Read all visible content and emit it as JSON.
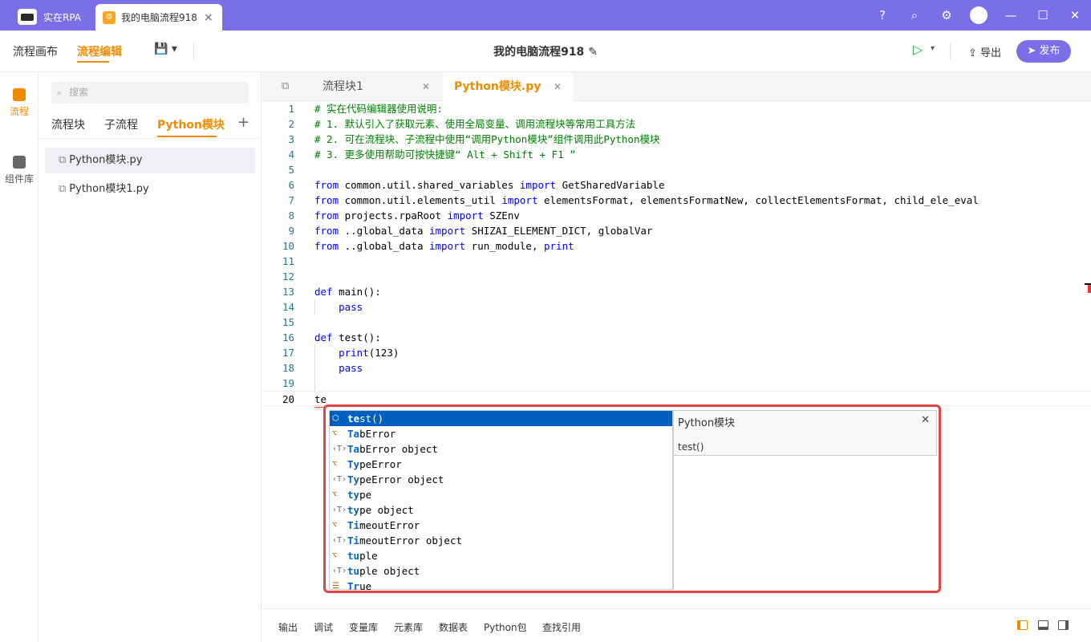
{
  "app": {
    "name": "实在RPA",
    "doc_tab": "我的电脑流程918"
  },
  "toolbar": {
    "canvas": "流程画布",
    "edit": "流程编辑",
    "title": "我的电脑流程918",
    "export": "导出",
    "publish": "发布"
  },
  "leftbar": {
    "flow": "流程",
    "lib": "组件库"
  },
  "sidebar": {
    "search_placeholder": "搜索",
    "tabs": [
      "流程块",
      "子流程",
      "Python模块"
    ],
    "files": [
      "Python模块.py",
      "Python模块1.py"
    ]
  },
  "editor": {
    "tabs": [
      "流程块1",
      "Python模块.py"
    ]
  },
  "code": {
    "lines": [
      {
        "n": "1",
        "t": "# 实在代码编辑器使用说明:"
      },
      {
        "n": "2",
        "t": "# 1. 默认引入了获取元素、使用全局变量、调用流程块等常用工具方法"
      },
      {
        "n": "3",
        "t": "# 2. 可在流程块、子流程中使用“调用Python模块”组件调用此Python模块"
      },
      {
        "n": "4",
        "t": "# 3. 更多使用帮助可按快捷键“ Alt + Shift + F1 ”"
      },
      {
        "n": "5",
        "t": ""
      },
      {
        "n": "6",
        "t": "from common.util.shared_variables import GetSharedVariable"
      },
      {
        "n": "7",
        "t": "from common.util.elements_util import elementsFormat, elementsFormatNew, collectElementsFormat, child_ele_eval"
      },
      {
        "n": "8",
        "t": "from projects.rpaRoot import SZEnv"
      },
      {
        "n": "9",
        "t": "from ..global_data import SHIZAI_ELEMENT_DICT, globalVar"
      },
      {
        "n": "10",
        "t": "from ..global_data import run_module, print"
      },
      {
        "n": "11",
        "t": ""
      },
      {
        "n": "12",
        "t": ""
      },
      {
        "n": "13",
        "t": "def main():"
      },
      {
        "n": "14",
        "t": "    pass"
      },
      {
        "n": "15",
        "t": ""
      },
      {
        "n": "16",
        "t": "def test():"
      },
      {
        "n": "17",
        "t": "    print(123)"
      },
      {
        "n": "18",
        "t": "    pass"
      },
      {
        "n": "19",
        "t": ""
      },
      {
        "n": "20",
        "t": "te"
      }
    ]
  },
  "suggest": {
    "items": [
      {
        "label": "test()",
        "kind": "module"
      },
      {
        "label": "TabError",
        "kind": "class"
      },
      {
        "label": "TabError object",
        "kind": "type"
      },
      {
        "label": "TypeError",
        "kind": "class"
      },
      {
        "label": "TypeError object",
        "kind": "type"
      },
      {
        "label": "type",
        "kind": "class"
      },
      {
        "label": "type object",
        "kind": "type"
      },
      {
        "label": "TimeoutError",
        "kind": "class"
      },
      {
        "label": "TimeoutError object",
        "kind": "type"
      },
      {
        "label": "tuple",
        "kind": "class"
      },
      {
        "label": "tuple object",
        "kind": "type"
      },
      {
        "label": "True",
        "kind": "keyword"
      }
    ],
    "detail_title": "Python模块",
    "detail_sig": "test()"
  },
  "bottom": {
    "tabs": [
      "输出",
      "调试",
      "变量库",
      "元素库",
      "数据表",
      "Python包",
      "查找引用"
    ]
  },
  "colors": {
    "accent": "#7b6fe8",
    "active": "#f08c00",
    "highlight_border": "#e04545"
  }
}
